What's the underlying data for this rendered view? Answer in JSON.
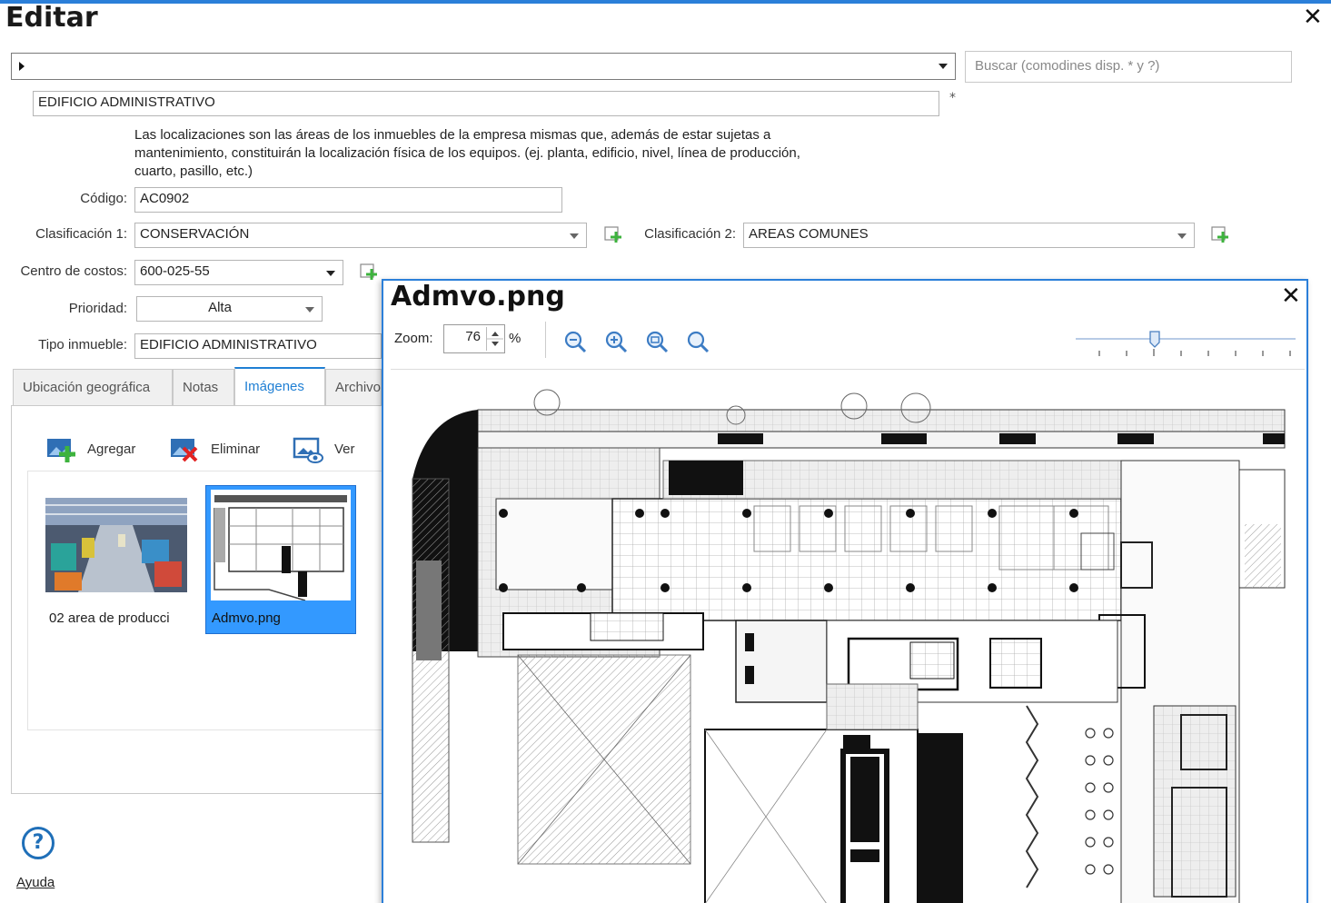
{
  "window": {
    "title": "Editar"
  },
  "search": {
    "placeholder": "Buscar (comodines disp. * y ?)"
  },
  "form": {
    "name": "EDIFICIO ADMINISTRATIVO",
    "required_mark": "*",
    "description": "Las localizaciones son las áreas de los inmuebles de la empresa mismas que, además de estar sujetas a mantenimiento, constituirán la localización física de los equipos. (ej. planta, edificio, nivel, línea de producción, cuarto, pasillo, etc.)",
    "codigo": {
      "label": "Código:",
      "value": "AC0902"
    },
    "clasificacion1": {
      "label": "Clasificación 1:",
      "value": "CONSERVACIÓN"
    },
    "clasificacion2": {
      "label": "Clasificación 2:",
      "value": "AREAS COMUNES"
    },
    "centro_costos": {
      "label": "Centro de costos:",
      "value": "600-025-55"
    },
    "prioridad": {
      "label": "Prioridad:",
      "value": "Alta"
    },
    "tipo_inmueble": {
      "label": "Tipo inmueble:",
      "value": "EDIFICIO ADMINISTRATIVO"
    }
  },
  "tabs": [
    {
      "label": "Ubicación geográfica"
    },
    {
      "label": "Notas"
    },
    {
      "label": "Imágenes"
    },
    {
      "label": "Archivo"
    }
  ],
  "images_toolbar": {
    "add": "Agregar",
    "delete": "Eliminar",
    "view": "Ver"
  },
  "images": [
    {
      "label": "02 area de producci"
    },
    {
      "label": "Admvo.png"
    }
  ],
  "help": {
    "label": "Ayuda"
  },
  "viewer": {
    "title": "Admvo.png",
    "zoom_label": "Zoom:",
    "zoom_value": "76",
    "zoom_unit": "%"
  },
  "icons": {
    "add": "plus-green-icon",
    "delete": "red-x-icon",
    "view": "eye-icon",
    "zoom_out": "zoom-out-icon",
    "zoom_in": "zoom-in-icon",
    "zoom_fit": "zoom-fit-icon",
    "zoom_actual": "zoom-actual-icon"
  },
  "colors": {
    "accent": "#2b7fd9",
    "selected": "#3399ff",
    "add_green": "#3db33d",
    "delete_red": "#e22222"
  }
}
